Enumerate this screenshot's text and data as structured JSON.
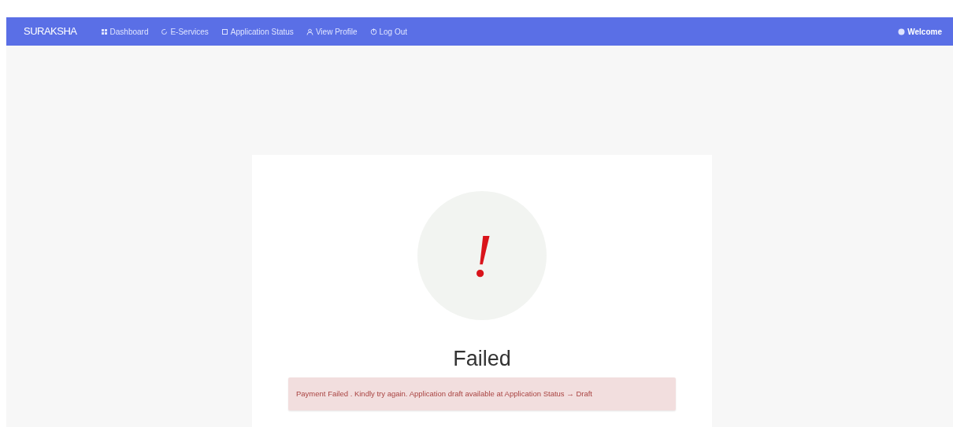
{
  "navbar": {
    "brand": "SURAKSHA",
    "items": [
      {
        "label": "Dashboard"
      },
      {
        "label": "E-Services"
      },
      {
        "label": "Application Status"
      },
      {
        "label": "View Profile"
      },
      {
        "label": "Log Out"
      }
    ],
    "user": {
      "label": "Welcome"
    }
  },
  "result": {
    "symbol": "!",
    "title": "Failed",
    "message": "Payment Failed . Kindly try again. Application draft available at Application Status → Draft"
  }
}
